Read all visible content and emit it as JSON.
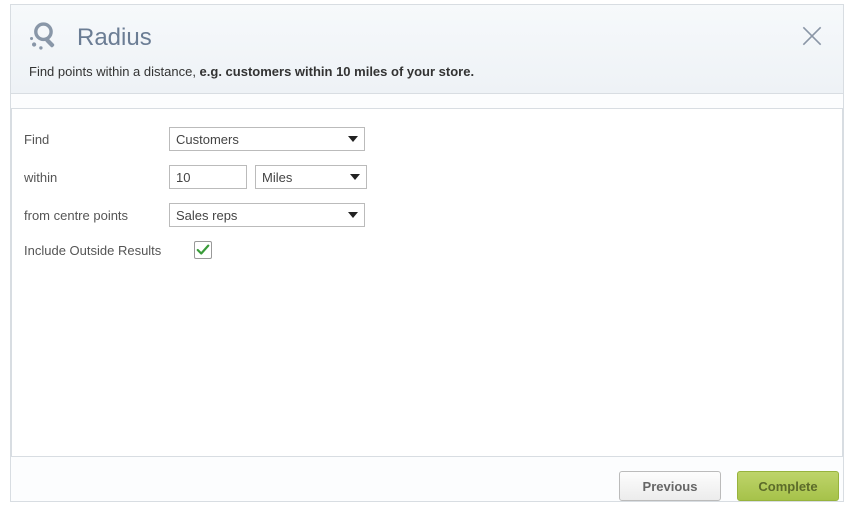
{
  "header": {
    "title": "Radius",
    "subtitle_lead": "Find points within a distance, ",
    "subtitle_bold": "e.g. customers within 10 miles of your store."
  },
  "form": {
    "find_label": "Find",
    "find_value": "Customers",
    "within_label": "within",
    "within_value": "10",
    "within_unit": "Miles",
    "from_label": "from centre points",
    "from_value": "Sales reps",
    "include_label": "Include Outside Results",
    "include_checked": true
  },
  "footer": {
    "previous": "Previous",
    "complete": "Complete"
  }
}
